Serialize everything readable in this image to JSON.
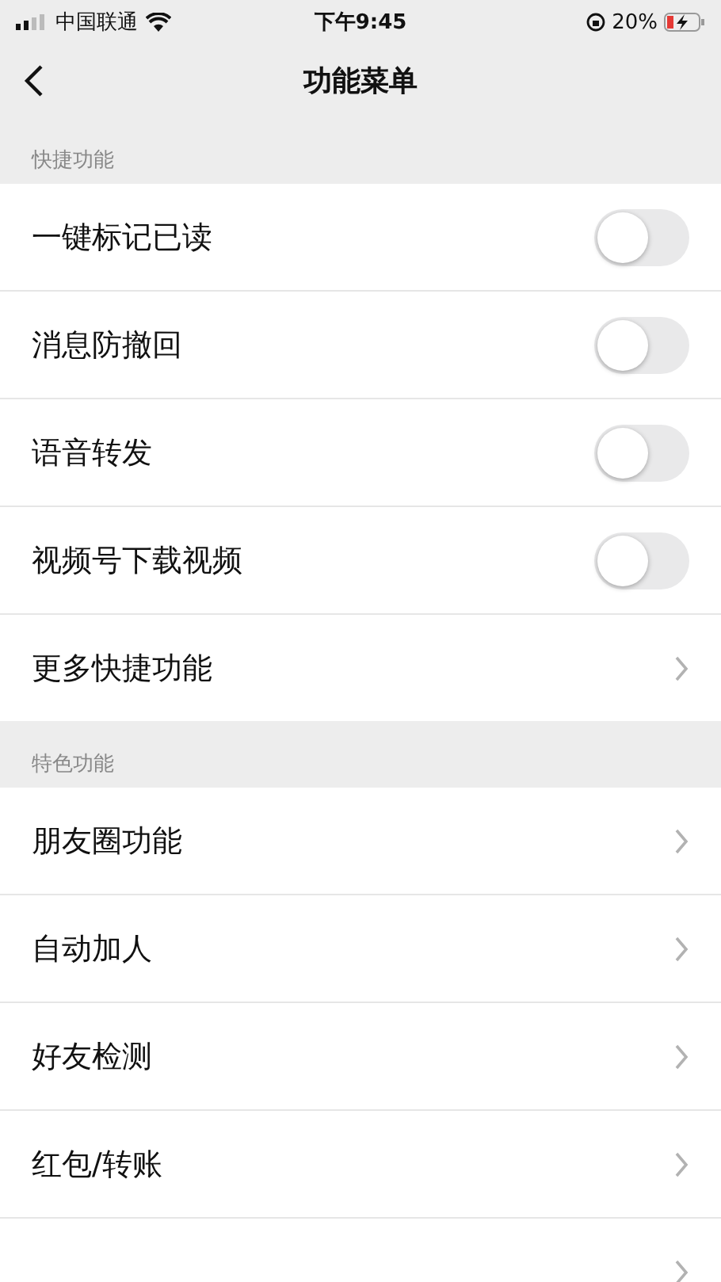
{
  "status_bar": {
    "carrier": "中国联通",
    "time": "下午9:45",
    "battery": "20%"
  },
  "nav": {
    "title": "功能菜单"
  },
  "sections": [
    {
      "header": "快捷功能",
      "items": [
        {
          "kind": "toggle",
          "label": "一键标记已读",
          "on": false
        },
        {
          "kind": "toggle",
          "label": "消息防撤回",
          "on": false
        },
        {
          "kind": "toggle",
          "label": "语音转发",
          "on": false
        },
        {
          "kind": "toggle",
          "label": "视频号下载视频",
          "on": false
        },
        {
          "kind": "link",
          "label": "更多快捷功能"
        }
      ]
    },
    {
      "header": "特色功能",
      "items": [
        {
          "kind": "link",
          "label": "朋友圈功能"
        },
        {
          "kind": "link",
          "label": "自动加人"
        },
        {
          "kind": "link",
          "label": "好友检测"
        },
        {
          "kind": "link",
          "label": "红包/转账"
        },
        {
          "kind": "link"
        }
      ]
    }
  ]
}
